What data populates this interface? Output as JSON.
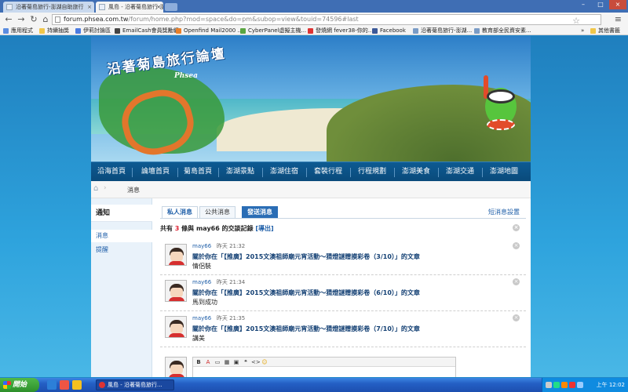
{
  "browser": {
    "tabs": [
      {
        "title": "沿著菊島旅行-澎湖自助旅行",
        "active": false
      },
      {
        "title": "風島 - 沿著菊島旅行-澎湖",
        "active": true
      }
    ],
    "url_host": "forum.phsea.com.tw",
    "url_path": "/forum/home.php?mod=space&do=pm&subop=view&touid=74596#last",
    "bookmarks": [
      "應用程式",
      "持續抽獎",
      "伊莉討論區",
      "EmailCash會員獎勵網",
      "Openfind Mail2000 ...",
      "CyberPanel虛擬主機...",
      "發燒網 fever38-你的...",
      "Facebook",
      "沿著菊島旅行-澎湖...",
      "教育部全民資安素...",
      "其他書籤"
    ],
    "overflow": "»"
  },
  "site": {
    "title": "沿著菊島旅行論壇",
    "subtitle": "Phsea",
    "nav": [
      "沿海首頁",
      "論壇首頁",
      "菊島首頁",
      "澎湖景點",
      "澎湖住宿",
      "套裝行程",
      "行程規劃",
      "澎湖美食",
      "澎湖交通",
      "澎湖地圖"
    ]
  },
  "breadcrumb": {
    "home": "⌂",
    "sep": "›",
    "current": "消息"
  },
  "sidebar": {
    "title": "通知",
    "items": [
      {
        "label": "消息",
        "active": true
      },
      {
        "label": "提醒",
        "active": false
      }
    ]
  },
  "tabs": {
    "private": "私人消息",
    "public": "公共消息",
    "send": "發送消息",
    "settings": "短消息設置"
  },
  "summary": {
    "prefix": "共有",
    "count": "3",
    "middle": "條與",
    "user": "may66",
    "suffix": "的交談記錄",
    "exit": "[導出]"
  },
  "messages": [
    {
      "user": "may66",
      "time": "昨天 21:32",
      "title": "關於你在「【推廣】2015文澳祖師廟元宵活動～猜燈謎贈摸彩卷（3/10）」的文章",
      "body": "情侶裝"
    },
    {
      "user": "may66",
      "time": "昨天 21:34",
      "title": "關於你在「【推廣】2015文澳祖師廟元宵活動～猜燈謎贈摸彩卷（6/10）」的文章",
      "body": "馬到成功"
    },
    {
      "user": "may66",
      "time": "昨天 21:35",
      "title": "關於你在「【推廣】2015文澳祖師廟元宵活動～猜燈謎贈摸彩卷（7/10）」的文章",
      "body": "講美"
    }
  ],
  "editor": {
    "tools": [
      "B",
      "A",
      "▭",
      "▦",
      "▣",
      "❝",
      "<>",
      "☺"
    ]
  },
  "taskbar": {
    "start": "開始",
    "window_title": "風島 - 沿著菊島旅行...",
    "clock": "上午 12:02"
  },
  "colors": {
    "nav_bg": "#0d5a92",
    "link": "#1e5ea8",
    "accent_red": "#d23",
    "page_bg": "#1f86c9"
  }
}
